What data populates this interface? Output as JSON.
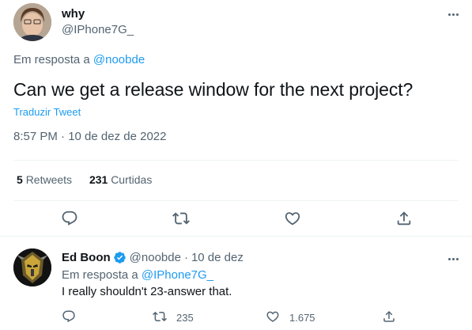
{
  "main_tweet": {
    "author_name": "why",
    "author_handle": "@IPhone7G_",
    "reply_prefix": "Em resposta a",
    "reply_to": "@noobde",
    "text": "Can we get a release window for the next project?",
    "translate_label": "Traduzir Tweet",
    "timestamp": "8:57 PM · 10 de dez de 2022",
    "retweets_count": "5",
    "retweets_label": "Retweets",
    "likes_count": "231",
    "likes_label": "Curtidas",
    "icons": [
      "reply-icon",
      "retweet-icon",
      "like-icon",
      "share-icon",
      "more-icon"
    ]
  },
  "reply_tweet": {
    "author_name": "Ed Boon",
    "author_handle": "@noobde",
    "separator": "·",
    "date": "10 de dez",
    "reply_prefix": "Em resposta a",
    "reply_to": "@IPhone7G_",
    "text": "I really shouldn't 23-answer that.",
    "retweets_count": "235",
    "likes_count": "1.675",
    "icons": [
      "verified-badge-icon",
      "reply-icon",
      "retweet-icon",
      "like-icon",
      "share-icon",
      "more-icon"
    ]
  },
  "colors": {
    "accent": "#1d9bf0",
    "text_primary": "#0f1419",
    "text_secondary": "#536471",
    "divider": "#eff3f4"
  }
}
